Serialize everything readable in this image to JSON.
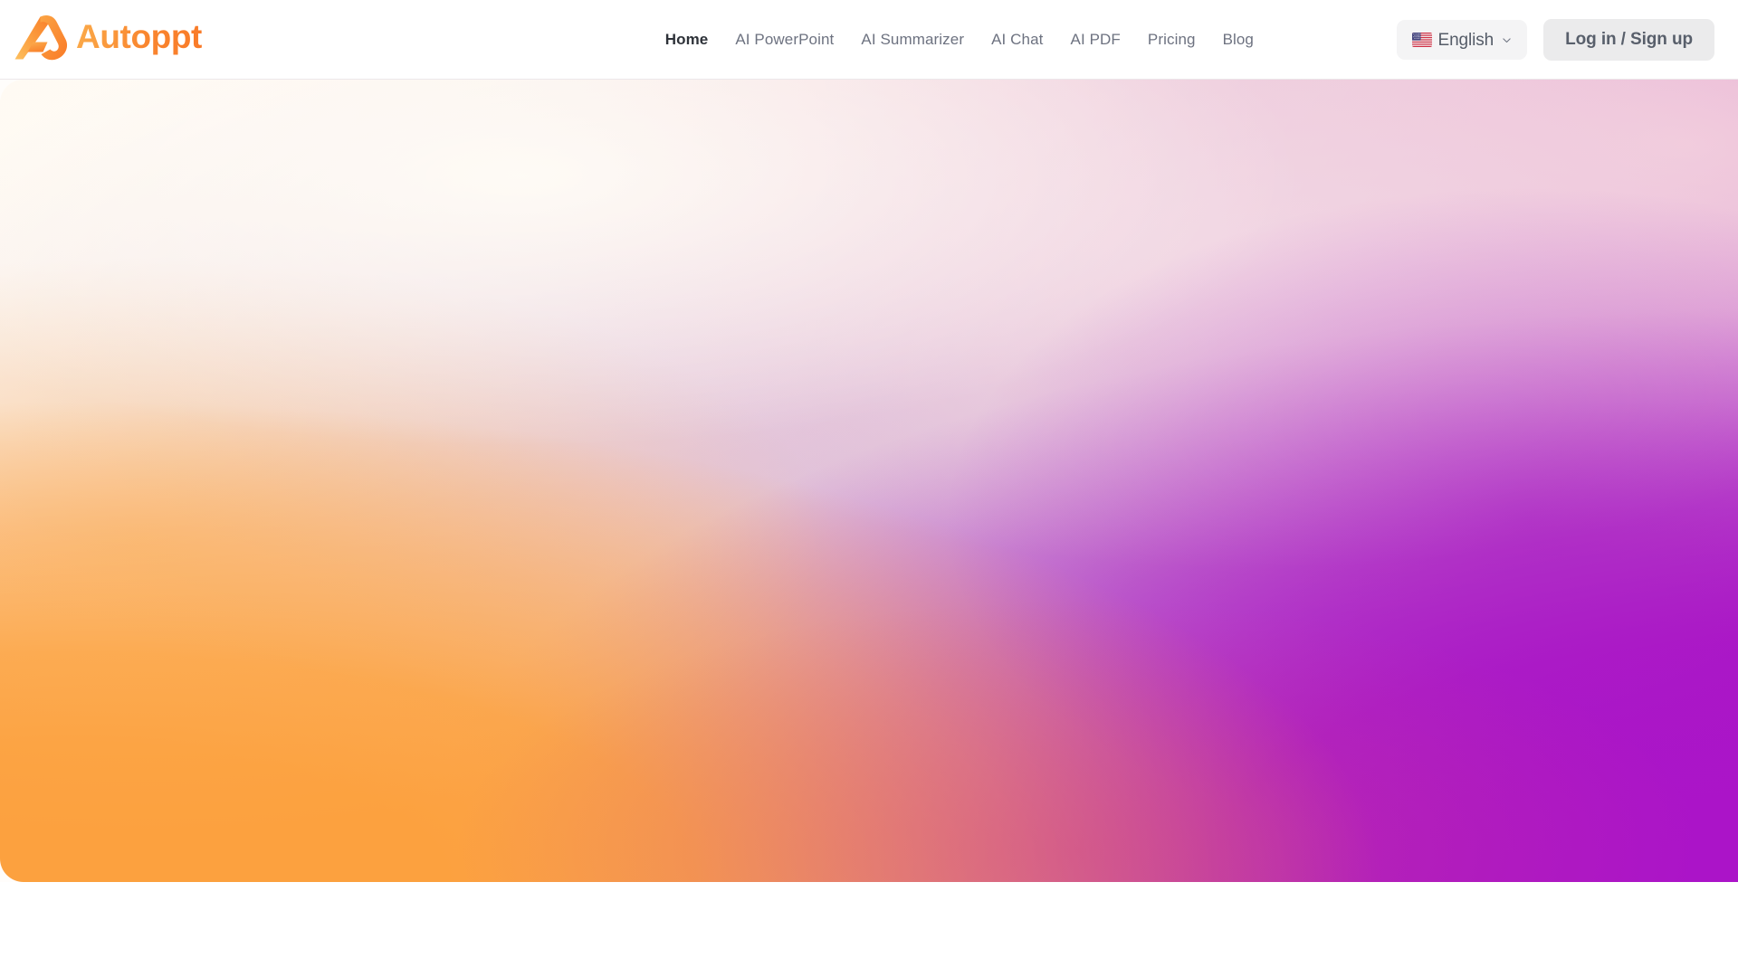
{
  "brand": {
    "name": "Autoppt",
    "logo_icon": "autoppt-a-logo-icon",
    "accent_orange": "#F9862F",
    "accent_orange_light": "#FBAB4A"
  },
  "header": {
    "nav": [
      {
        "label": "Home",
        "active": true
      },
      {
        "label": "AI PowerPoint",
        "active": false
      },
      {
        "label": "AI Summarizer",
        "active": false
      },
      {
        "label": "AI Chat",
        "active": false
      },
      {
        "label": "AI PDF",
        "active": false
      },
      {
        "label": "Pricing",
        "active": false
      },
      {
        "label": "Blog",
        "active": false
      }
    ],
    "language": {
      "label": "English",
      "flag_icon": "us-flag-icon",
      "chevron_icon": "chevron-down-icon"
    },
    "auth": {
      "login_label": "Log in / Sign up"
    },
    "background": "#FFFFFF",
    "border_color": "#ECE7EA"
  },
  "hero": {
    "gradient_name": "mesh-gradient-hero",
    "colors": {
      "top_left_cream": "#FFFBF4",
      "top_right_pink": "#F4D6E1",
      "center_mauve": "#CDACCE",
      "bottom_left_orange": "#FCA13F",
      "bottom_mid_rose": "#D1597F",
      "bottom_right_purple": "#AB14C8"
    },
    "corner_radius_px": 26
  }
}
